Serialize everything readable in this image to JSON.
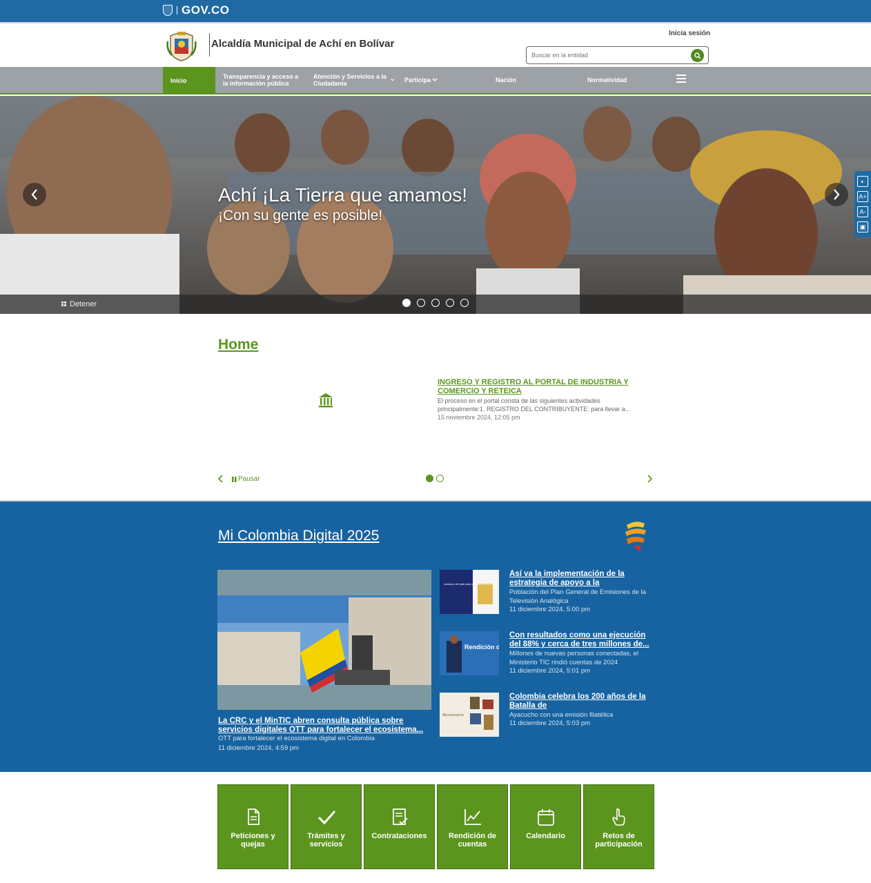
{
  "govbar": {
    "brand": "GOV.CO"
  },
  "header": {
    "site_title": "Alcaldía Municipal de Achí en Bolívar",
    "login": "Inicia sesión",
    "search_placeholder": "Buscar en la entidad"
  },
  "nav": {
    "items": [
      {
        "label": "Inicio",
        "active": true
      },
      {
        "label": "Transparencia y acceso a la información pública",
        "active": false
      },
      {
        "label": "Atención y Servicios a la Ciudadanía",
        "active": false
      },
      {
        "label": "Participa",
        "active": false
      },
      {
        "label": "Nación",
        "active": false
      },
      {
        "label": "Normatividad",
        "active": false
      }
    ]
  },
  "hero": {
    "title": "Achí ¡La Tierra que amamos!",
    "subtitle": "¡Con su gente es posible!",
    "stop_label": "Detener",
    "slide_count": 5,
    "active_slide": 1
  },
  "home": {
    "title": "Home",
    "news": {
      "title": "INGRESO Y REGISTRO AL PORTAL DE INDUSTRIA Y COMERCIO Y RETEICA",
      "description": "El proceso en el portal consta de las siguientes actividades principalmente:1. REGISTRO DEL CONTRIBUYENTE: para llevar a...",
      "date": "15 noviembre 2024, 12:05 pm"
    },
    "pause_label": "Pausar",
    "slide_count": 2,
    "active_slide": 1
  },
  "colombia_digital": {
    "title": "Mi Colombia Digital 2025",
    "main": {
      "title": "La CRC y el MinTIC abren consulta pública sobre servicios digitales OTT para fortalecer el ecosistema...",
      "description": "OTT para fortalecer el ecosistema digital en Colombia",
      "date": "11 diciembre 2024, 4:59 pm"
    },
    "items": [
      {
        "title": "Así va la implementación de la estrategia de apoyo a la",
        "description": "Población del Plan General de Emisiones de la Televisión Analógica",
        "date": "11 diciembre 2024, 5:00 pm",
        "thumb_text": "Avances del plan para la transición a la TDT"
      },
      {
        "title": "Con resultados como una ejecución del 88% y cerca de tres millones de...",
        "description": "Millones de nuevas personas conectadas, el Ministerio TIC rindió cuentas de 2024",
        "date": "11 diciembre 2024, 5:01 pm",
        "thumb_text": "Rendición de cuentas"
      },
      {
        "title": "Colombia celebra los 200 años de la Batalla de",
        "description": "Ayacucho con una emisión filatélica",
        "date": "11 diciembre 2024, 5:03 pm",
        "thumb_text": "Bicentenario"
      }
    ]
  },
  "tiles": [
    {
      "label": "Peticiones y quejas",
      "icon": "document-icon"
    },
    {
      "label": "Trámites y servicios",
      "icon": "check-icon"
    },
    {
      "label": "Contrataciones",
      "icon": "clipboard-check-icon"
    },
    {
      "label": "Rendición de cuentas",
      "icon": "chart-line-icon"
    },
    {
      "label": "Calendario",
      "icon": "calendar-icon"
    },
    {
      "label": "Retos de participación",
      "icon": "hand-pointer-icon"
    }
  ],
  "colors": {
    "gov_blue": "#1f6aa3",
    "brand_green": "#5b951d",
    "nav_gray": "#9da2a6",
    "section_blue": "#1763a1"
  }
}
